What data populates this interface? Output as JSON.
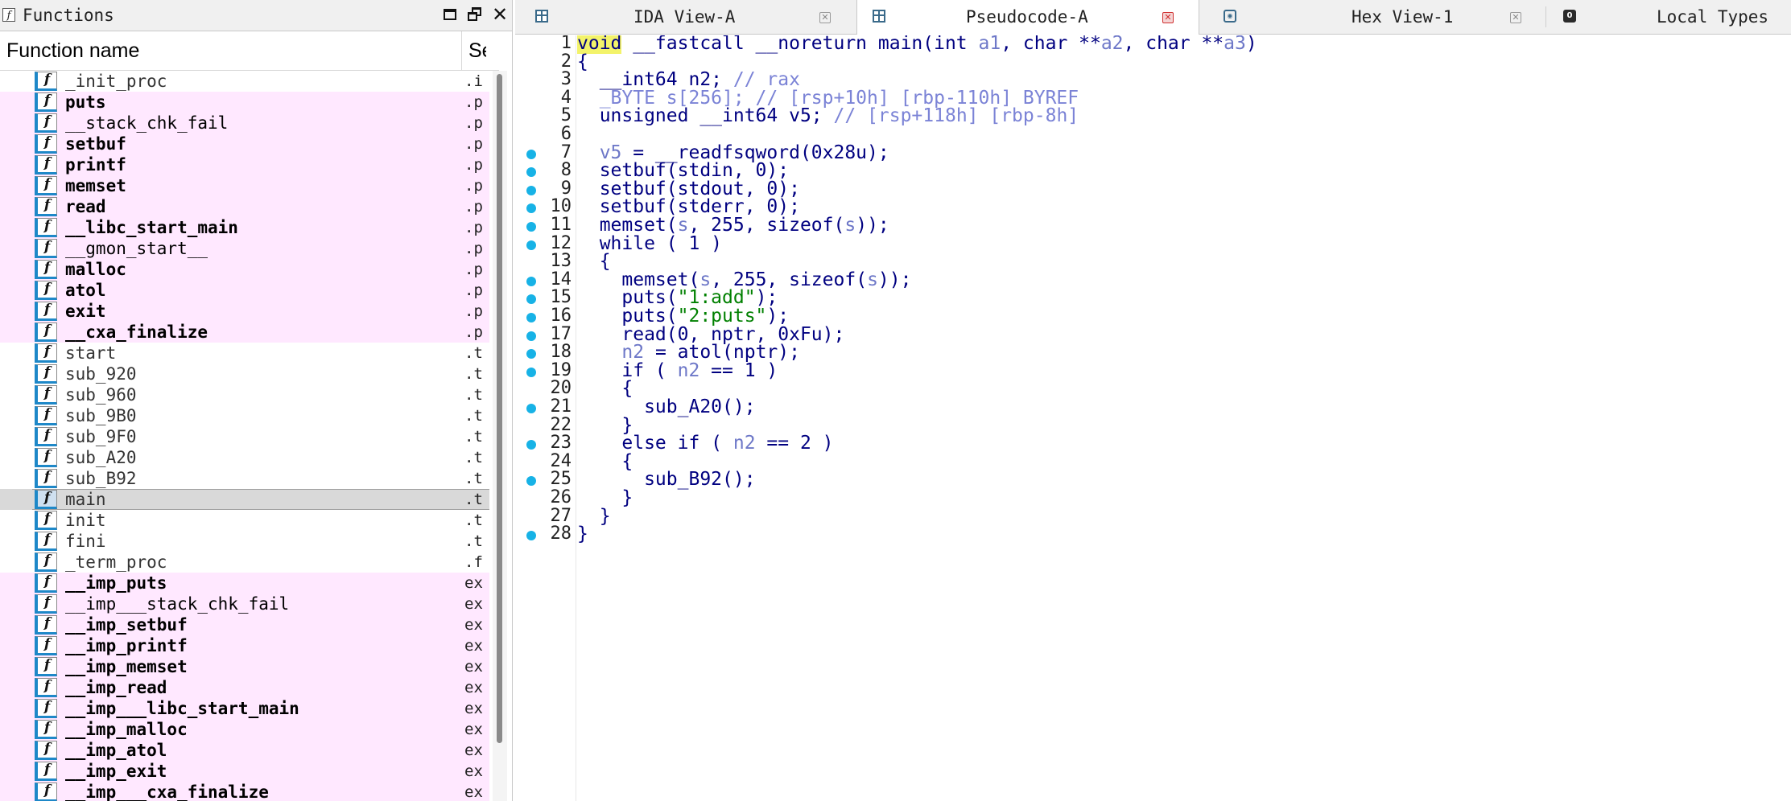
{
  "functions_panel": {
    "title": "Functions",
    "header": {
      "name": "Function name",
      "segment": "Se"
    },
    "icon_glyph": "f",
    "items": [
      {
        "name": "_init_proc",
        "segment": ".i",
        "lib": false,
        "bold": false
      },
      {
        "name": "puts",
        "segment": ".p",
        "lib": true,
        "bold": true
      },
      {
        "name": "__stack_chk_fail",
        "segment": ".p",
        "lib": true,
        "bold": false
      },
      {
        "name": "setbuf",
        "segment": ".p",
        "lib": true,
        "bold": true
      },
      {
        "name": "printf",
        "segment": ".p",
        "lib": true,
        "bold": true
      },
      {
        "name": "memset",
        "segment": ".p",
        "lib": true,
        "bold": true
      },
      {
        "name": "read",
        "segment": ".p",
        "lib": true,
        "bold": true
      },
      {
        "name": "__libc_start_main",
        "segment": ".p",
        "lib": true,
        "bold": true
      },
      {
        "name": "__gmon_start__",
        "segment": ".p",
        "lib": true,
        "bold": false
      },
      {
        "name": "malloc",
        "segment": ".p",
        "lib": true,
        "bold": true
      },
      {
        "name": "atol",
        "segment": ".p",
        "lib": true,
        "bold": true
      },
      {
        "name": "exit",
        "segment": ".p",
        "lib": true,
        "bold": true
      },
      {
        "name": "__cxa_finalize",
        "segment": ".p",
        "lib": true,
        "bold": true
      },
      {
        "name": "start",
        "segment": ".t",
        "lib": false,
        "bold": false
      },
      {
        "name": "sub_920",
        "segment": ".t",
        "lib": false,
        "bold": false
      },
      {
        "name": "sub_960",
        "segment": ".t",
        "lib": false,
        "bold": false
      },
      {
        "name": "sub_9B0",
        "segment": ".t",
        "lib": false,
        "bold": false
      },
      {
        "name": "sub_9F0",
        "segment": ".t",
        "lib": false,
        "bold": false
      },
      {
        "name": "sub_A20",
        "segment": ".t",
        "lib": false,
        "bold": false
      },
      {
        "name": "sub_B92",
        "segment": ".t",
        "lib": false,
        "bold": false
      },
      {
        "name": "main",
        "segment": ".t",
        "lib": false,
        "bold": false,
        "selected": true
      },
      {
        "name": "init",
        "segment": ".t",
        "lib": false,
        "bold": false
      },
      {
        "name": "fini",
        "segment": ".t",
        "lib": false,
        "bold": false
      },
      {
        "name": "_term_proc",
        "segment": ".f",
        "lib": false,
        "bold": false
      },
      {
        "name": "__imp_puts",
        "segment": "ex",
        "lib": true,
        "bold": true
      },
      {
        "name": "__imp___stack_chk_fail",
        "segment": "ex",
        "lib": true,
        "bold": false
      },
      {
        "name": "__imp_setbuf",
        "segment": "ex",
        "lib": true,
        "bold": true
      },
      {
        "name": "__imp_printf",
        "segment": "ex",
        "lib": true,
        "bold": true
      },
      {
        "name": "__imp_memset",
        "segment": "ex",
        "lib": true,
        "bold": true
      },
      {
        "name": "__imp_read",
        "segment": "ex",
        "lib": true,
        "bold": true
      },
      {
        "name": "__imp___libc_start_main",
        "segment": "ex",
        "lib": true,
        "bold": true
      },
      {
        "name": "__imp_malloc",
        "segment": "ex",
        "lib": true,
        "bold": true
      },
      {
        "name": "__imp_atol",
        "segment": "ex",
        "lib": true,
        "bold": true
      },
      {
        "name": "__imp_exit",
        "segment": "ex",
        "lib": true,
        "bold": true
      },
      {
        "name": "__imp___cxa_finalize",
        "segment": "ex",
        "lib": true,
        "bold": true
      }
    ]
  },
  "tabs": [
    {
      "label": "IDA View-A",
      "icon": "grid-icon",
      "active": false,
      "close": "gray"
    },
    {
      "label": "Pseudocode-A",
      "icon": "grid-icon",
      "active": true,
      "close": "red"
    },
    {
      "label": "Hex View-1",
      "icon": "hex-icon",
      "active": false,
      "close": "gray"
    },
    {
      "label": "Local Types",
      "icon": "types-icon",
      "active": false,
      "close": "none"
    }
  ],
  "colors": {
    "keyword": "#000080",
    "variable": "#6e78c8",
    "comment": "#7b83d6",
    "string": "#008000",
    "breakpoint": "#17b2e6",
    "lib_row": "#ffe8ff",
    "highlight": "#f3f36a"
  },
  "code": {
    "lines": [
      {
        "num": "1",
        "bp": false,
        "tokens": [
          [
            "hl",
            "void"
          ],
          [
            "k",
            " __fastcall __noreturn main(int "
          ],
          [
            "v",
            "a1"
          ],
          [
            "k",
            ", char **"
          ],
          [
            "v",
            "a2"
          ],
          [
            "k",
            ", char **"
          ],
          [
            "v",
            "a3"
          ],
          [
            "k",
            ")"
          ]
        ]
      },
      {
        "num": "2",
        "bp": false,
        "tokens": [
          [
            "k",
            "{"
          ]
        ]
      },
      {
        "num": "3",
        "bp": false,
        "tokens": [
          [
            "k",
            "  __int64 n2; "
          ],
          [
            "c",
            "// rax"
          ]
        ]
      },
      {
        "num": "4",
        "bp": false,
        "tokens": [
          [
            "c",
            "  _BYTE s[256]; // [rsp+10h] [rbp-110h] BYREF"
          ]
        ]
      },
      {
        "num": "5",
        "bp": false,
        "tokens": [
          [
            "k",
            "  unsigned __int64 v5; "
          ],
          [
            "c",
            "// [rsp+118h] [rbp-8h]"
          ]
        ]
      },
      {
        "num": "6",
        "bp": false,
        "tokens": []
      },
      {
        "num": "7",
        "bp": true,
        "tokens": [
          [
            "v",
            "  v5"
          ],
          [
            "k",
            " = __readfsqword(0x28u);"
          ]
        ]
      },
      {
        "num": "8",
        "bp": true,
        "tokens": [
          [
            "k",
            "  setbuf(stdin, 0);"
          ]
        ]
      },
      {
        "num": "9",
        "bp": true,
        "tokens": [
          [
            "k",
            "  setbuf(stdout, 0);"
          ]
        ]
      },
      {
        "num": "10",
        "bp": true,
        "tokens": [
          [
            "k",
            "  setbuf(stderr, 0);"
          ]
        ]
      },
      {
        "num": "11",
        "bp": true,
        "tokens": [
          [
            "k",
            "  memset("
          ],
          [
            "v",
            "s"
          ],
          [
            "k",
            ", 255, sizeof("
          ],
          [
            "v",
            "s"
          ],
          [
            "k",
            "));"
          ]
        ]
      },
      {
        "num": "12",
        "bp": true,
        "tokens": [
          [
            "k",
            "  while ( 1 )"
          ]
        ]
      },
      {
        "num": "13",
        "bp": false,
        "tokens": [
          [
            "k",
            "  {"
          ]
        ]
      },
      {
        "num": "14",
        "bp": true,
        "tokens": [
          [
            "k",
            "    memset("
          ],
          [
            "v",
            "s"
          ],
          [
            "k",
            ", 255, sizeof("
          ],
          [
            "v",
            "s"
          ],
          [
            "k",
            "));"
          ]
        ]
      },
      {
        "num": "15",
        "bp": true,
        "tokens": [
          [
            "k",
            "    puts("
          ],
          [
            "s",
            "\"1:add\""
          ],
          [
            "k",
            ");"
          ]
        ]
      },
      {
        "num": "16",
        "bp": true,
        "tokens": [
          [
            "k",
            "    puts("
          ],
          [
            "s",
            "\"2:puts\""
          ],
          [
            "k",
            ");"
          ]
        ]
      },
      {
        "num": "17",
        "bp": true,
        "tokens": [
          [
            "k",
            "    read(0, nptr, 0xFu);"
          ]
        ]
      },
      {
        "num": "18",
        "bp": true,
        "tokens": [
          [
            "v",
            "    n2"
          ],
          [
            "k",
            " = atol(nptr);"
          ]
        ]
      },
      {
        "num": "19",
        "bp": true,
        "tokens": [
          [
            "k",
            "    if ( "
          ],
          [
            "v",
            "n2"
          ],
          [
            "k",
            " == 1 )"
          ]
        ]
      },
      {
        "num": "20",
        "bp": false,
        "tokens": [
          [
            "k",
            "    {"
          ]
        ]
      },
      {
        "num": "21",
        "bp": true,
        "tokens": [
          [
            "k",
            "      sub_A20();"
          ]
        ]
      },
      {
        "num": "22",
        "bp": false,
        "tokens": [
          [
            "k",
            "    }"
          ]
        ]
      },
      {
        "num": "23",
        "bp": true,
        "tokens": [
          [
            "k",
            "    else if ( "
          ],
          [
            "v",
            "n2"
          ],
          [
            "k",
            " == 2 )"
          ]
        ]
      },
      {
        "num": "24",
        "bp": false,
        "tokens": [
          [
            "k",
            "    {"
          ]
        ]
      },
      {
        "num": "25",
        "bp": true,
        "tokens": [
          [
            "k",
            "      sub_B92();"
          ]
        ]
      },
      {
        "num": "26",
        "bp": false,
        "tokens": [
          [
            "k",
            "    }"
          ]
        ]
      },
      {
        "num": "27",
        "bp": false,
        "tokens": [
          [
            "k",
            "  }"
          ]
        ]
      },
      {
        "num": "28",
        "bp": true,
        "tokens": [
          [
            "k",
            "}"
          ]
        ]
      }
    ]
  }
}
